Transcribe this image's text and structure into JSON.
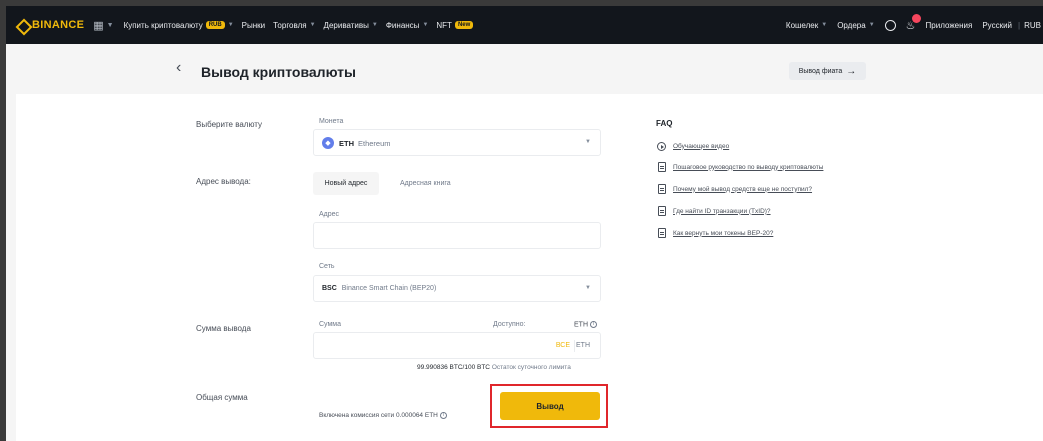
{
  "nav": {
    "logo": "BINANCE",
    "menu": [
      {
        "label": "Купить криптовалюту",
        "badge": "RUB"
      },
      {
        "label": "Рынки"
      },
      {
        "label": "Торговля"
      },
      {
        "label": "Деривативы"
      },
      {
        "label": "Финансы"
      },
      {
        "label": "NFT",
        "badge": "New"
      }
    ],
    "right": {
      "wallet": "Кошелек",
      "orders": "Ордера",
      "apps": "Приложения",
      "language": "Русский",
      "currency": "RUB"
    }
  },
  "header": {
    "title": "Вывод криптовалюты",
    "fiat_button": "Вывод фиата"
  },
  "form": {
    "currency_label": "Выберите валюту",
    "coin_label": "Монета",
    "coin_ticker": "ETH",
    "coin_name": "Ethereum",
    "address_label": "Адрес вывода:",
    "tab_new": "Новый адрес",
    "tab_book": "Адресная книга",
    "address_field_label": "Адрес",
    "address_value": "",
    "network_label": "Сеть",
    "network_code": "BSC",
    "network_name": "Binance Smart Chain (BEP20)",
    "amount_section_label": "Сумма вывода",
    "amount_label": "Сумма",
    "available_label": "Доступно:",
    "available_unit": "ETH",
    "amount_value": "",
    "max_label": "ВСЕ",
    "amount_unit": "ETH",
    "limit_value": "99.990836 BTC/100 BTC",
    "limit_label": "Остаток суточного лимита",
    "total_label": "Общая сумма",
    "fee_text": "Включена комиссия сети 0.000064 ETH",
    "withdraw_button": "Вывод"
  },
  "faq": {
    "title": "FAQ",
    "items": [
      {
        "icon": "play-icon",
        "text": "Обучающее видео"
      },
      {
        "icon": "document-icon",
        "text": "Пошаговое руководство по выводу криптовалюты"
      },
      {
        "icon": "document-icon",
        "text": "Почему мой вывод средств еще не поступил?"
      },
      {
        "icon": "document-icon",
        "text": "Где найти ID транзакции (TxID)?"
      },
      {
        "icon": "document-icon",
        "text": "Как вернуть мои токены BEP-20?"
      }
    ]
  },
  "colors": {
    "brand": "#f0b90b",
    "nav_bg": "#12161c",
    "highlight": "#e0262b"
  }
}
